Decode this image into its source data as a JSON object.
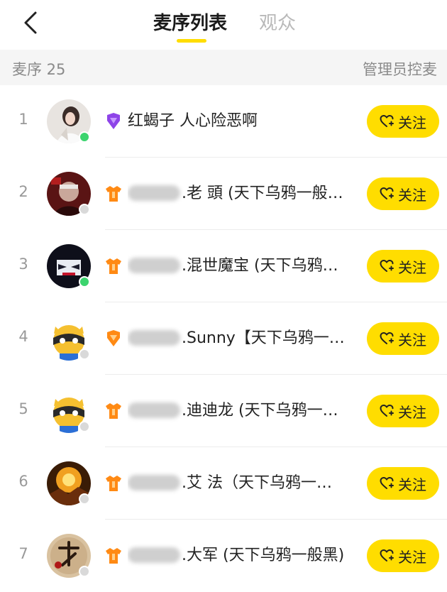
{
  "header": {
    "tabs": [
      {
        "label": "麦序列表",
        "active": true
      },
      {
        "label": "观众",
        "active": false
      }
    ],
    "accent_color": "#ffdd00"
  },
  "subbar": {
    "left": "麦序 25",
    "right": "管理员控麦"
  },
  "follow_label": "关注",
  "rows": [
    {
      "rank": "1",
      "name_prefix": "",
      "name": "红蝎子 人心险恶啊",
      "badge": "purple-crest-icon",
      "online": true
    },
    {
      "rank": "2",
      "name_prefix": "blurred",
      "name": ".老  頭 (天下乌鸦一般…",
      "badge": "orange-shirt-icon",
      "online": false
    },
    {
      "rank": "3",
      "name_prefix": "blurred",
      "name": ".混世魔宝 (天下乌鸦…",
      "badge": "orange-shirt-icon",
      "online": true
    },
    {
      "rank": "4",
      "name_prefix": "blurred",
      "name": ".Sunny【天下乌鸦一…",
      "badge": "orange-crest-icon",
      "online": false
    },
    {
      "rank": "5",
      "name_prefix": "blurred",
      "name": ".迪迪龙 (天下乌鸦一…",
      "badge": "orange-shirt-icon",
      "online": false
    },
    {
      "rank": "6",
      "name_prefix": "blurred",
      "name": ".艾 法（天下乌鸦一…",
      "badge": "orange-shirt-icon",
      "online": false
    },
    {
      "rank": "7",
      "name_prefix": "blurred",
      "name": ".大军 (天下乌鸦一般黑)",
      "badge": "orange-shirt-icon",
      "online": false
    }
  ]
}
